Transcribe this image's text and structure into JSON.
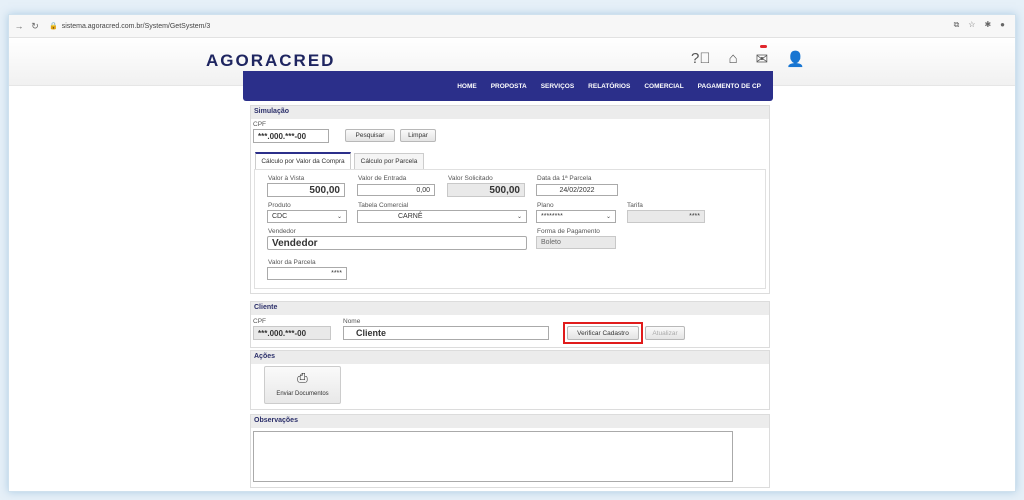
{
  "browser": {
    "url": "sistema.agoracred.com.br/System/GetSystem/3"
  },
  "app": {
    "logo": "AGORACRED"
  },
  "nav": {
    "items": [
      "HOME",
      "PROPOSTA",
      "SERVIÇOS",
      "RELATÓRIOS",
      "COMERCIAL",
      "PAGAMENTO DE CP"
    ]
  },
  "simulacao": {
    "title": "Simulação",
    "cpf_label": "CPF",
    "cpf_value": "***.000.***-00",
    "pesquisar": "Pesquisar",
    "limpar": "Limpar",
    "tabs": [
      "Cálculo por Valor da Compra",
      "Cálculo por Parcela"
    ],
    "valor_vista_label": "Valor à Vista",
    "valor_vista": "500,00",
    "valor_entrada_label": "Valor de Entrada",
    "valor_entrada": "0,00",
    "valor_solicitado_label": "Valor Solicitado",
    "valor_solicitado": "500,00",
    "data_parcela_label": "Data da 1ª Parcela",
    "data_parcela": "24/02/2022",
    "produto_label": "Produto",
    "produto": "CDC",
    "tabela_label": "Tabela Comercial",
    "tabela": "CARNÊ",
    "plano_label": "Plano",
    "plano": "********",
    "tarifa_label": "Tarifa",
    "tarifa": "****",
    "vendedor_label": "Vendedor",
    "vendedor": "Vendedor",
    "forma_pagamento_label": "Forma de Pagamento",
    "forma_pagamento": "Boleto",
    "valor_parcela_label": "Valor da Parcela",
    "valor_parcela": "****"
  },
  "cliente": {
    "title": "Cliente",
    "cpf_label": "CPF",
    "cpf_value": "***.000.***-00",
    "nome_label": "Nome",
    "nome_value": "Cliente",
    "verificar": "Verificar Cadastro",
    "atualizar": "Atualizar"
  },
  "acoes": {
    "title": "Ações",
    "enviar": "Enviar Documentos"
  },
  "observacoes": {
    "title": "Observações"
  },
  "colors": {
    "navbar": "#2b2f8a",
    "highlight": "#e01b1b"
  }
}
